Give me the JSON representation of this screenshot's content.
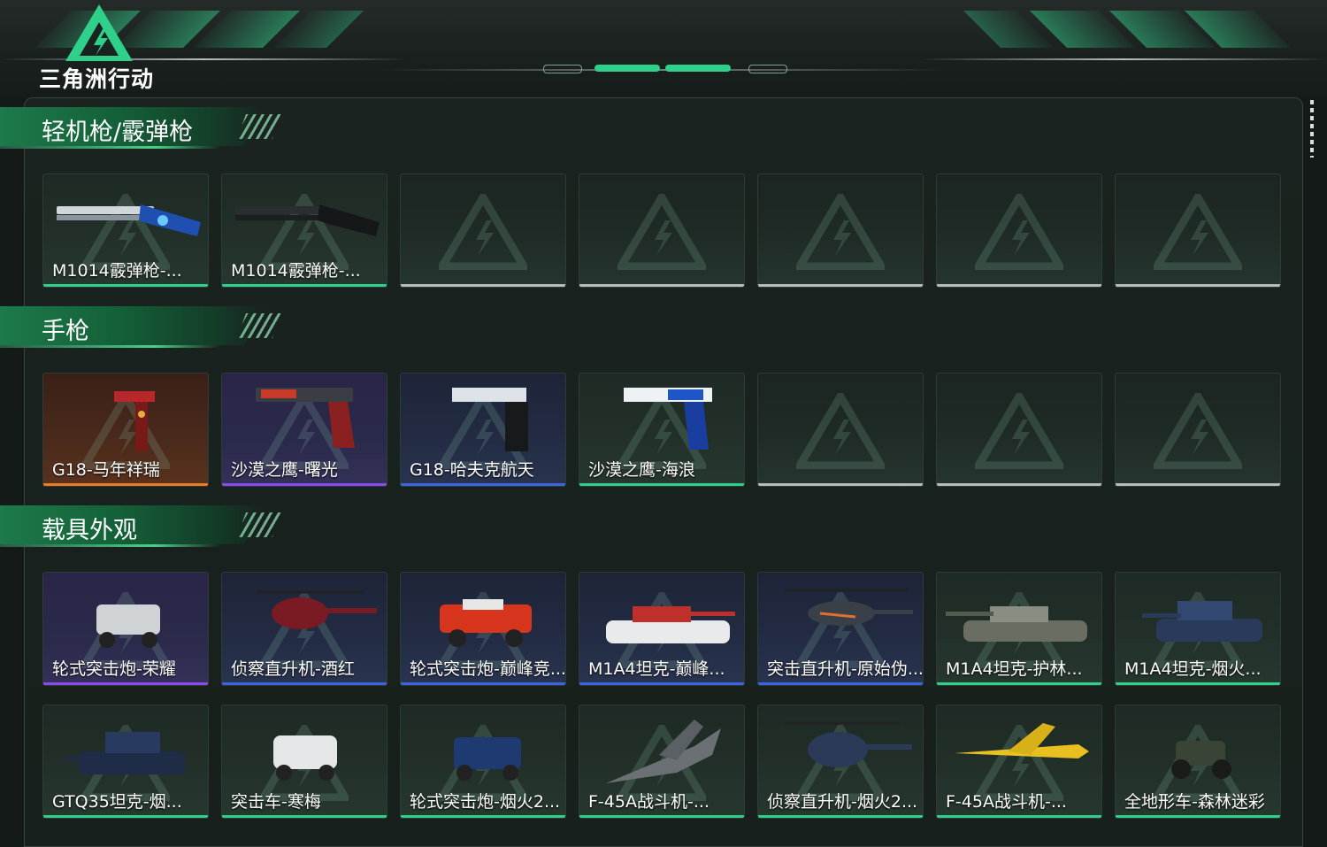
{
  "app": {
    "logo_text": "三角洲行动",
    "colors": {
      "accent": "#2fd08a",
      "purple": "#8a4af0",
      "orange": "#f07a22",
      "blue": "#3a66e0",
      "empty": "#b8bcbb"
    }
  },
  "sections": [
    {
      "title": "轻机枪/霰弹枪",
      "items": [
        {
          "label": "M1014霰弹枪-...",
          "rarity": "green",
          "icon": "shotgun-blue"
        },
        {
          "label": "M1014霰弹枪-...",
          "rarity": "green",
          "icon": "shotgun-black"
        },
        {
          "label": "",
          "rarity": "empty"
        },
        {
          "label": "",
          "rarity": "empty"
        },
        {
          "label": "",
          "rarity": "empty"
        },
        {
          "label": "",
          "rarity": "empty"
        },
        {
          "label": "",
          "rarity": "empty"
        }
      ]
    },
    {
      "title": "手枪",
      "items": [
        {
          "label": "G18-马年祥瑞",
          "rarity": "orange",
          "icon": "pistol-red"
        },
        {
          "label": "沙漠之鹰-曙光",
          "rarity": "purple",
          "icon": "deagle-dark"
        },
        {
          "label": "G18-哈夫克航天",
          "rarity": "blue",
          "icon": "pistol-white"
        },
        {
          "label": "沙漠之鹰-海浪",
          "rarity": "green",
          "icon": "deagle-blue"
        },
        {
          "label": "",
          "rarity": "empty"
        },
        {
          "label": "",
          "rarity": "empty"
        },
        {
          "label": "",
          "rarity": "empty"
        }
      ]
    },
    {
      "title": "载具外观",
      "items": [
        {
          "label": "轮式突击炮-荣耀",
          "rarity": "purple",
          "icon": "armored-car-white"
        },
        {
          "label": "侦察直升机-酒红",
          "rarity": "blue",
          "icon": "helicopter-red"
        },
        {
          "label": "轮式突击炮-巅峰竞...",
          "rarity": "blue",
          "icon": "armored-car-red"
        },
        {
          "label": "M1A4坦克-巅峰...",
          "rarity": "blue",
          "icon": "tank-red"
        },
        {
          "label": "突击直升机-原始伪...",
          "rarity": "blue",
          "icon": "attack-helicopter"
        },
        {
          "label": "M1A4坦克-护林...",
          "rarity": "green",
          "icon": "tank-camo"
        },
        {
          "label": "M1A4坦克-烟火...",
          "rarity": "green",
          "icon": "tank-blue"
        },
        {
          "label": "GTQ35坦克-烟...",
          "rarity": "green",
          "icon": "tank-blue-2"
        },
        {
          "label": "突击车-寒梅",
          "rarity": "green",
          "icon": "assault-vehicle-white"
        },
        {
          "label": "轮式突击炮-烟火2...",
          "rarity": "green",
          "icon": "armored-car-blue"
        },
        {
          "label": "F-45A战斗机-...",
          "rarity": "green",
          "icon": "jet-gray"
        },
        {
          "label": "侦察直升机-烟火2...",
          "rarity": "green",
          "icon": "helicopter-blue"
        },
        {
          "label": "F-45A战斗机-...",
          "rarity": "green",
          "icon": "jet-yellow"
        },
        {
          "label": "全地形车-森林迷彩",
          "rarity": "green",
          "icon": "atv-camo"
        }
      ]
    }
  ]
}
